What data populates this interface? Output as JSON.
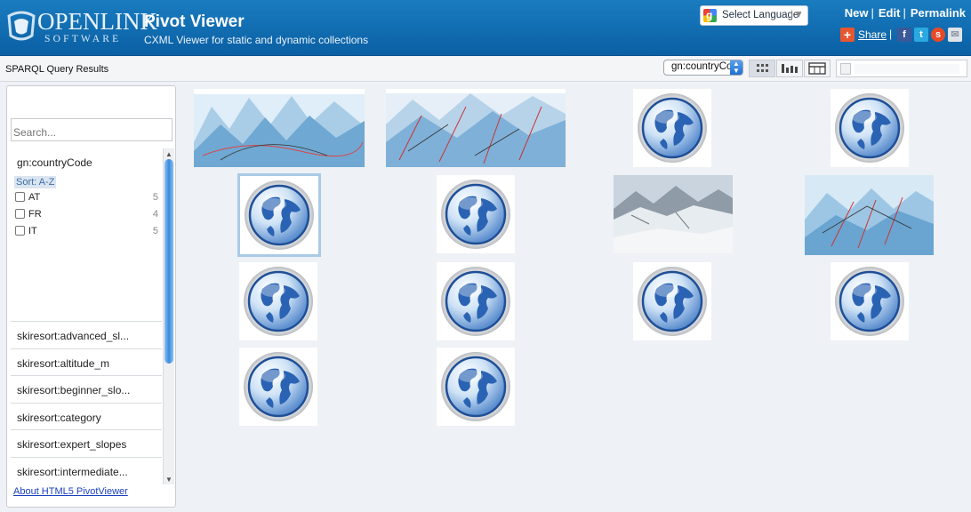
{
  "header": {
    "logo_main": "OPENLINK",
    "logo_sub": "SOFTWARE",
    "title": "Pivot Viewer",
    "subtitle": "CXML Viewer for static and dynamic collections",
    "language_label": "Select Language",
    "links": {
      "new": "New",
      "edit": "Edit",
      "permalink": "Permalink"
    },
    "share_label": "Share"
  },
  "toolbar": {
    "title": "SPARQL Query Results",
    "sort_value": "gn:countryCode"
  },
  "panel": {
    "search_placeholder": "Search...",
    "open_facet": {
      "name": "gn:countryCode",
      "sort_label": "Sort: A-Z",
      "values": [
        {
          "label": "AT",
          "count": "5"
        },
        {
          "label": "FR",
          "count": "4"
        },
        {
          "label": "IT",
          "count": "5"
        }
      ]
    },
    "facets": [
      "skiresort:advanced_sl...",
      "skiresort:altitude_m",
      "skiresort:beginner_slo...",
      "skiresort:category",
      "skiresort:expert_slopes",
      "skiresort:intermediate..."
    ],
    "about_link": "About HTML5 PivotViewer"
  },
  "colors": {
    "header_blue": "#0a5fa3",
    "selected_outline": "#a9cbe6",
    "link_blue": "#1a3fbf"
  },
  "grid": {
    "items": [
      {
        "kind": "map-photo",
        "icon": "piste-map-image"
      },
      {
        "kind": "map-photo",
        "icon": "piste-map-image"
      },
      {
        "kind": "globe",
        "icon": "globe-icon"
      },
      {
        "kind": "globe",
        "icon": "globe-icon"
      },
      {
        "kind": "globe",
        "icon": "globe-icon",
        "selected": true
      },
      {
        "kind": "globe",
        "icon": "globe-icon"
      },
      {
        "kind": "snow-photo",
        "icon": "mountain-photo"
      },
      {
        "kind": "map-photo",
        "icon": "piste-map-image"
      },
      {
        "kind": "globe",
        "icon": "globe-icon"
      },
      {
        "kind": "globe",
        "icon": "globe-icon"
      },
      {
        "kind": "globe",
        "icon": "globe-icon"
      },
      {
        "kind": "globe",
        "icon": "globe-icon"
      },
      {
        "kind": "globe",
        "icon": "globe-icon"
      },
      {
        "kind": "globe",
        "icon": "globe-icon"
      }
    ]
  }
}
